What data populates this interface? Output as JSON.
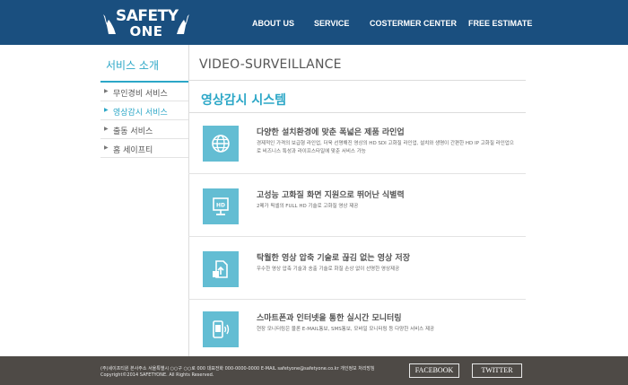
{
  "header": {
    "logo_line1": "SAFETY",
    "logo_line2": "ONE",
    "nav": [
      "ABOUT US",
      "SERVICE",
      "COSTERMER CENTER",
      "FREE  ESTIMATE"
    ]
  },
  "sidebar": {
    "title": "서비스 소개",
    "items": [
      {
        "label": "무인경비 서비스",
        "active": false
      },
      {
        "label": "영상감시 서비스",
        "active": true
      },
      {
        "label": "출동 서비스",
        "active": false
      },
      {
        "label": "홈 세이프티",
        "active": false
      }
    ]
  },
  "main": {
    "title": "VIDEO-SURVEILLANCE",
    "subtitle": "영상감시 시스템",
    "features": [
      {
        "icon": "globe-icon",
        "title": "다양한 설치환경에 맞춘 폭넓은 제품 라인업",
        "desc": "경제적인 가격의 보급형 라인업, 더욱 선명해진 영상의 HD SDI 고화질 라인업, 설치와 생명이 간편한 HD IP 고화질 라인업으로 비즈니스 특성과 라이프스타일에 맞춘 서비스 가능"
      },
      {
        "icon": "hd-monitor-icon",
        "title": "고성능 고화질 화면 지원으로 뛰어난 식별력",
        "desc": "2메가 픽셀의 FULL HD 기술로 고화질 영상 제공"
      },
      {
        "icon": "upload-document-icon",
        "title": "탁월한 영상 압축 기술로 끊김 없는 영상 저장",
        "desc": "우수한 영상 압축 기술과 송출 기술로 화질 손상 없이 선명한 영상제공"
      },
      {
        "icon": "smartphone-signal-icon",
        "title": "스마트폰과 인터넷을 통한 실시간 모니터링",
        "desc": "현장 모니터링은 물론 E-MAIL통보, SMS통보, 모바일 모니터링 등 다양한 서비스 제공"
      }
    ]
  },
  "footer": {
    "address": "(주)세이프티원  본사주소  서울특별시 ○○구 ○○로 000  대표전화 000-0000-0000  E-MAIL  safetyone@safetyone.co.kr  개인정보 처리방침",
    "copyright": "Copyright©2014  SAFETYONE.  All Rights Reserved.",
    "facebook": "FACEBOOK",
    "twitter": "TWITTER"
  },
  "colors": {
    "header_bg": "#1a4f7f",
    "accent": "#2ca7c7",
    "icon_bg": "#63bdd3",
    "footer_bg": "#4e4a46"
  }
}
